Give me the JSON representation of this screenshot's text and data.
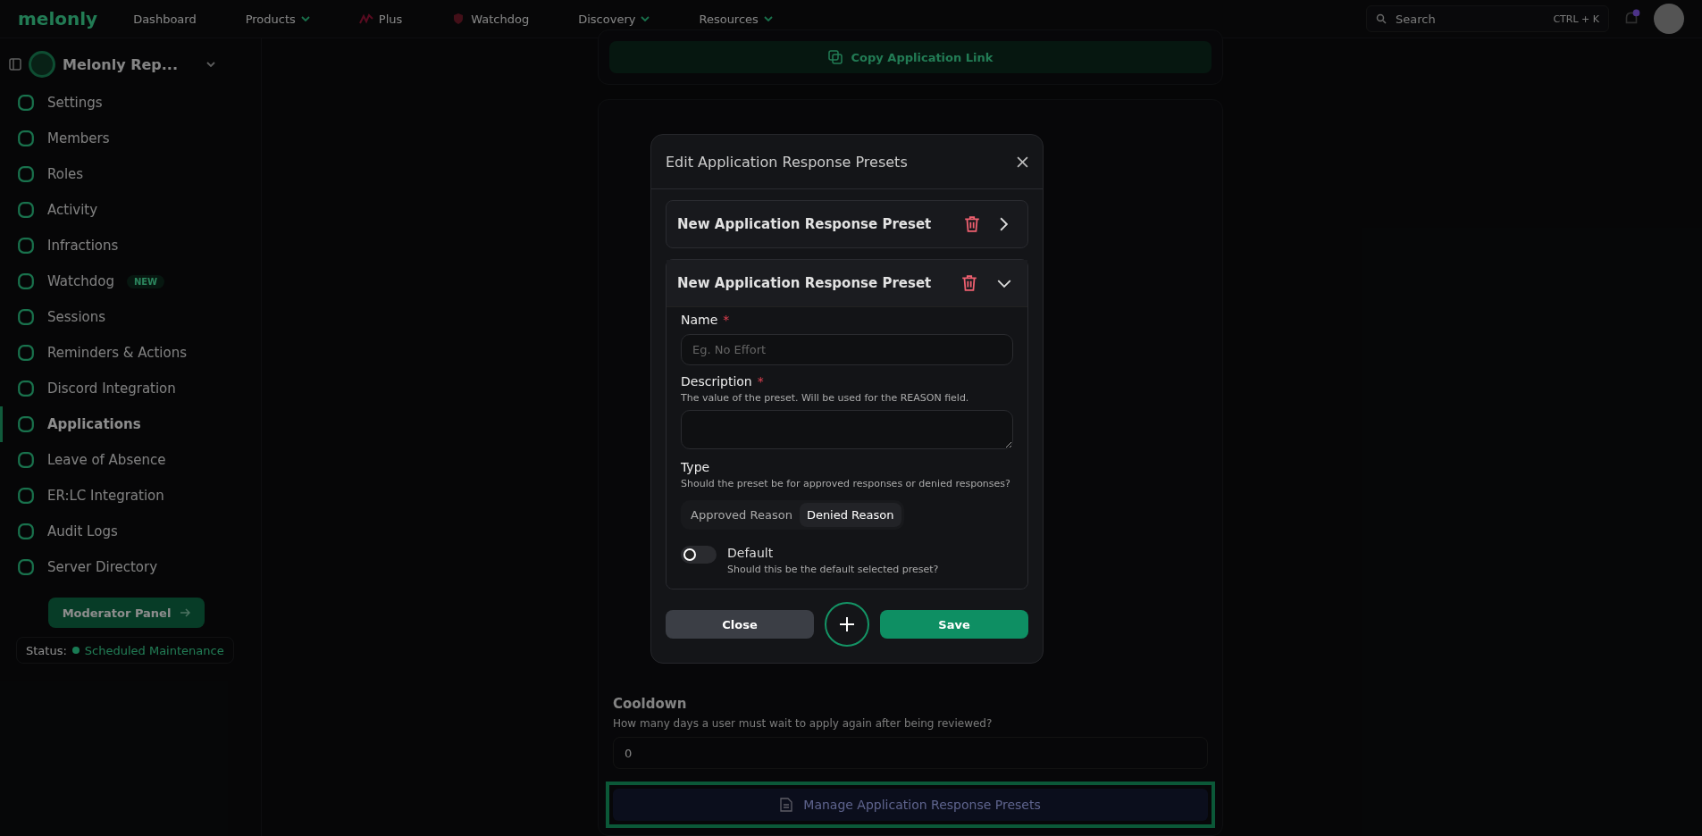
{
  "nav": {
    "logo": "melonly",
    "items": [
      {
        "label": "Dashboard",
        "dropdown": false,
        "kind": "plain"
      },
      {
        "label": "Products",
        "dropdown": true,
        "kind": "plain"
      },
      {
        "label": "Plus",
        "dropdown": false,
        "kind": "plus"
      },
      {
        "label": "Watchdog",
        "dropdown": false,
        "kind": "shield"
      },
      {
        "label": "Discovery",
        "dropdown": true,
        "kind": "plain"
      },
      {
        "label": "Resources",
        "dropdown": true,
        "kind": "plain"
      }
    ],
    "search": {
      "placeholder": "Search",
      "shortcut": "CTRL + K"
    }
  },
  "sidebar": {
    "server_name": "Melonly Rep...",
    "items": [
      {
        "label": "Settings",
        "selected": false
      },
      {
        "label": "Members",
        "selected": false
      },
      {
        "label": "Roles",
        "selected": false
      },
      {
        "label": "Activity",
        "selected": false
      },
      {
        "label": "Infractions",
        "selected": false
      },
      {
        "label": "Watchdog",
        "selected": false,
        "badge": "NEW"
      },
      {
        "label": "Sessions",
        "selected": false
      },
      {
        "label": "Reminders & Actions",
        "selected": false
      },
      {
        "label": "Discord Integration",
        "selected": false
      },
      {
        "label": "Applications",
        "selected": true
      },
      {
        "label": "Leave of Absence",
        "selected": false
      },
      {
        "label": "ER:LC Integration",
        "selected": false
      },
      {
        "label": "Audit Logs",
        "selected": false
      },
      {
        "label": "Server Directory",
        "selected": false
      }
    ],
    "panel_button": "Moderator Panel",
    "status_label": "Status:",
    "status": "Scheduled Maintenance"
  },
  "main": {
    "copy_button": "Copy Application Link",
    "cooldown": {
      "label": "Cooldown",
      "description": "How many days a user must wait to apply again after being reviewed?",
      "value": "0"
    },
    "manage_button": "Manage Application Response Presets"
  },
  "modal": {
    "title": "Edit Application Response Presets",
    "presets": [
      {
        "title": "New Application Response Preset",
        "expanded": false
      },
      {
        "title": "New Application Response Preset",
        "expanded": true
      }
    ],
    "form": {
      "name_label": "Name",
      "required_mark": "*",
      "name_placeholder": "Eg. No Effort",
      "description_label": "Description",
      "description_hint": "The value of the preset. Will be used for the REASON field.",
      "type_label": "Type",
      "type_hint": "Should the preset be for approved responses or denied responses?",
      "type_options": [
        {
          "label": "Approved Reason",
          "selected": false
        },
        {
          "label": "Denied Reason",
          "selected": true
        }
      ],
      "default_label": "Default",
      "default_hint": "Should this be the default selected preset?",
      "default_on": false
    },
    "buttons": {
      "close": "Close",
      "save": "Save"
    }
  }
}
